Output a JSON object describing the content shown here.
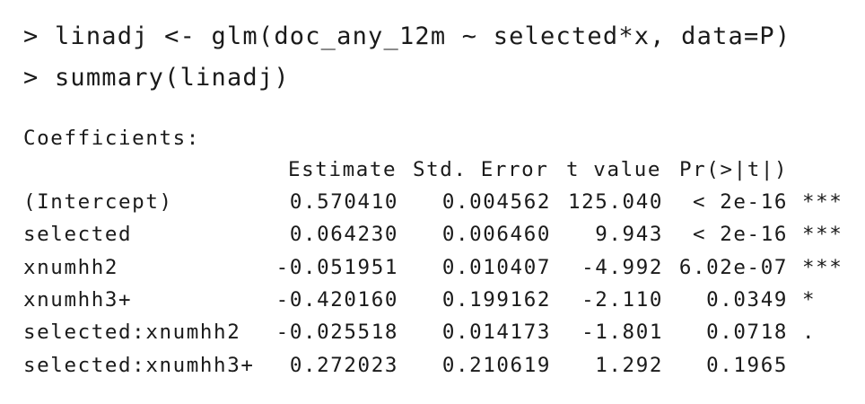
{
  "console": {
    "commands": [
      {
        "prompt": ">",
        "text": "linadj <- glm(doc_any_12m ~ selected*x, data=P)"
      },
      {
        "prompt": ">",
        "text": "summary(linadj)"
      }
    ],
    "coefficients_title": "Coefficients:",
    "table": {
      "headers": {
        "estimate": "Estimate",
        "std_error": "Std. Error",
        "t_value": "t value",
        "p_value": "Pr(>|t|)"
      },
      "rows": [
        {
          "name": "(Intercept)",
          "estimate": "0.570410",
          "std_error": "0.004562",
          "t_value": "125.040",
          "p_value": "< 2e-16",
          "signif": "***"
        },
        {
          "name": "selected",
          "estimate": "0.064230",
          "std_error": "0.006460",
          "t_value": "9.943",
          "p_value": "< 2e-16",
          "signif": "***"
        },
        {
          "name": "xnumhh2",
          "estimate": "-0.051951",
          "std_error": "0.010407",
          "t_value": "-4.992",
          "p_value": "6.02e-07",
          "signif": "***"
        },
        {
          "name": "xnumhh3+",
          "estimate": "-0.420160",
          "std_error": "0.199162",
          "t_value": "-2.110",
          "p_value": "0.0349",
          "signif": "*"
        },
        {
          "name": "selected:xnumhh2",
          "estimate": "-0.025518",
          "std_error": "0.014173",
          "t_value": "-1.801",
          "p_value": "0.0718",
          "signif": "."
        },
        {
          "name": "selected:xnumhh3+",
          "estimate": "0.272023",
          "std_error": "0.210619",
          "t_value": "1.292",
          "p_value": "0.1965",
          "signif": ""
        }
      ]
    }
  }
}
